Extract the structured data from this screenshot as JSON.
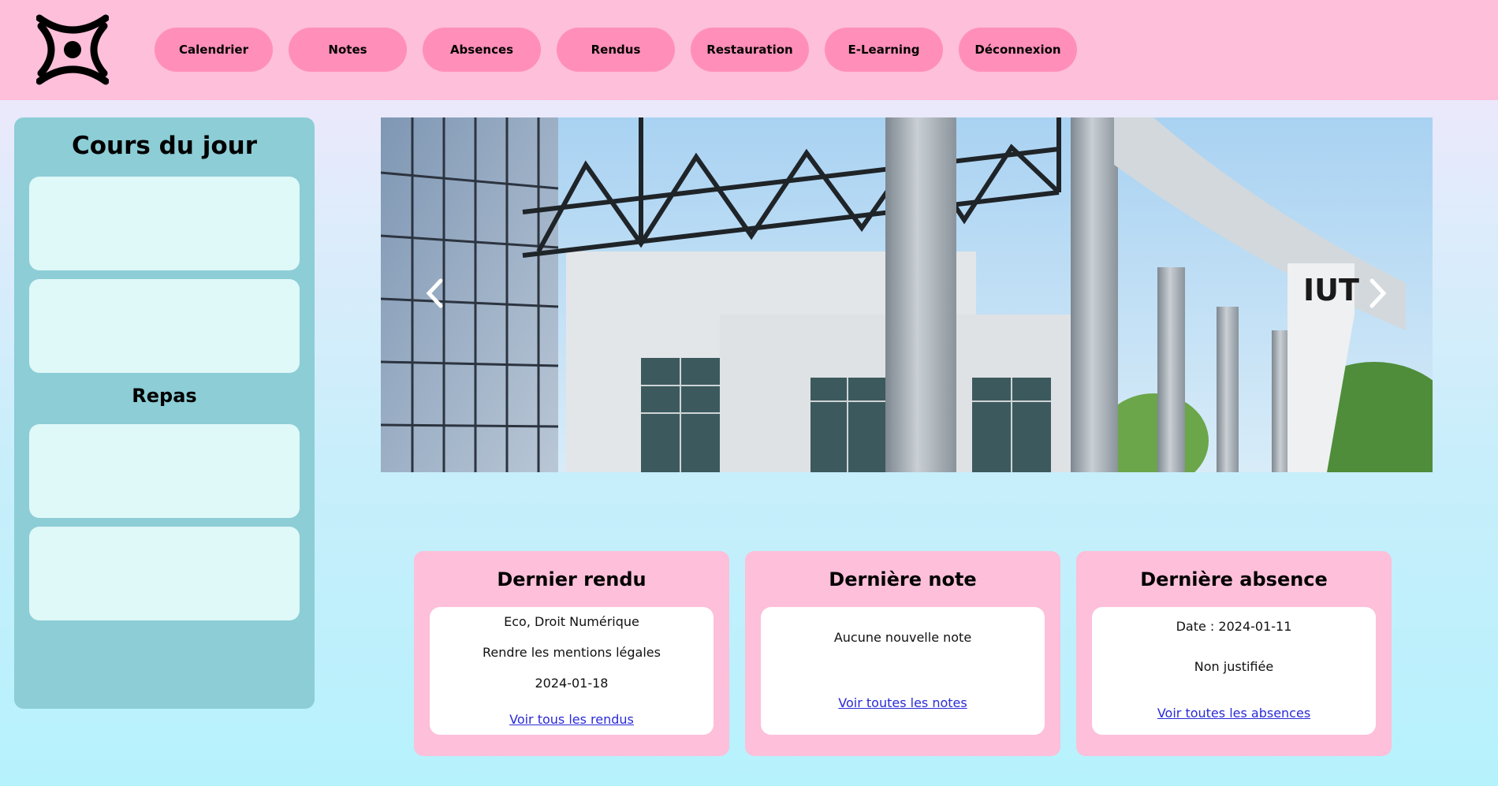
{
  "header": {
    "logo_icon": "sun-burst-logo-icon",
    "nav": [
      {
        "label": "Calendrier"
      },
      {
        "label": "Notes"
      },
      {
        "label": "Absences"
      },
      {
        "label": "Rendus"
      },
      {
        "label": "Restauration"
      },
      {
        "label": "E-Learning"
      },
      {
        "label": "Déconnexion"
      }
    ]
  },
  "sidebar": {
    "title": "Cours du jour",
    "meals_title": "Repas"
  },
  "carousel": {
    "sign_text": "IUT",
    "prev_icon": "chevron-left-icon",
    "next_icon": "chevron-right-icon"
  },
  "cards": {
    "rendu": {
      "title": "Dernier rendu",
      "subject": "Eco, Droit Numérique",
      "task": "Rendre les mentions légales",
      "date": "2024-01-18",
      "link": "Voir tous les rendus"
    },
    "note": {
      "title": "Dernière note",
      "text": "Aucune nouvelle note",
      "link": "Voir toutes les notes"
    },
    "absence": {
      "title": "Dernière absence",
      "date": "Date : 2024-01-11",
      "status": "Non justifiée",
      "link": "Voir toutes les absences"
    }
  },
  "colors": {
    "header_bg": "#fdbfd9",
    "nav_button": "#ff8fb8",
    "sidebar_bg": "#8ccdd6",
    "slot_bg": "#dff8f8",
    "card_bg": "#fdbfd9",
    "link": "#2a2ad8"
  }
}
